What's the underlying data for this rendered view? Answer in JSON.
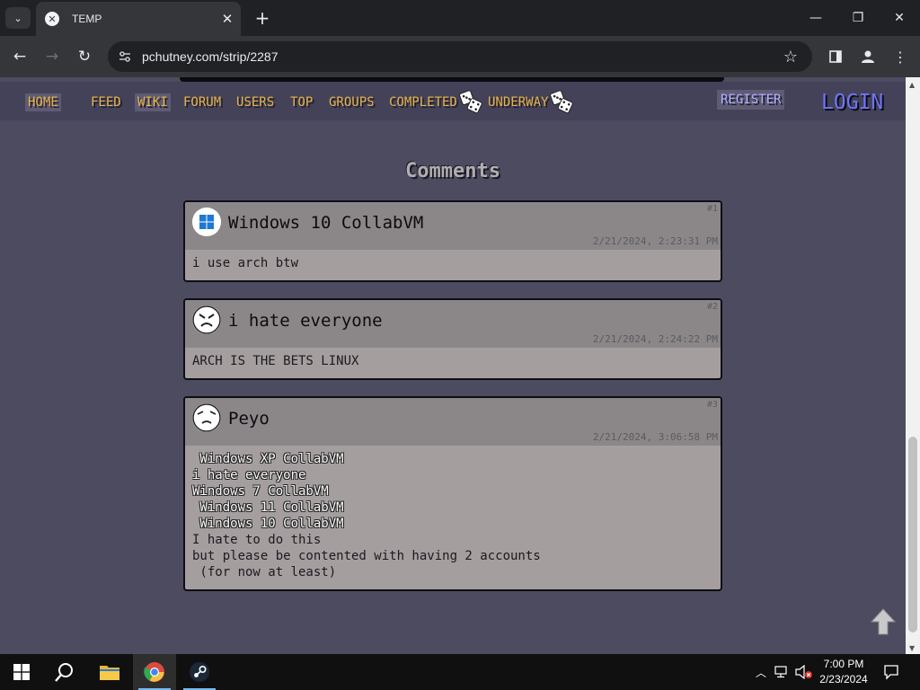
{
  "browser": {
    "tab": {
      "title": "TEMP",
      "favicon": "favicon-icon"
    },
    "url": "pchutney.com/strip/2287"
  },
  "site_nav": {
    "links": [
      "HOME",
      "FEED",
      "WIKI",
      "FORUM",
      "USERS",
      "TOP",
      "GROUPS",
      "COMPLETED",
      "UNDERWAY"
    ],
    "register": "REGISTER",
    "login": "LOGIN"
  },
  "comments": {
    "title": "Comments",
    "items": [
      {
        "user": "Windows 10 CollabVM",
        "number": "#1",
        "date": "2/21/2024, 2:23:31 PM",
        "avatar": "windows-logo-icon",
        "body": "i use arch btw"
      },
      {
        "user": "i hate everyone",
        "number": "#2",
        "date": "2/21/2024, 2:24:22 PM",
        "avatar": "angry-face-icon",
        "body": "ARCH IS THE BETS LINUX"
      },
      {
        "user": "Peyo",
        "number": "#3",
        "date": "2/21/2024, 3:06:58 PM",
        "avatar": "sad-face-icon",
        "body_outlined": [
          " Windows XP CollabVM",
          "i hate everyone",
          "Windows 7 CollabVM",
          " Windows 11 CollabVM",
          " Windows 10 CollabVM"
        ],
        "body_plain": [
          "I hate to do this",
          "but please be contented with having 2 accounts",
          " (for now at least)"
        ]
      }
    ]
  },
  "taskbar": {
    "time": "7:00 PM",
    "date": "2/23/2024"
  },
  "colors": {
    "page_bg": "#4d4b60",
    "nav_link": "#e6b34a",
    "login": "#6e74f5",
    "register": "#aab0ff",
    "comment_body": "#a59e9f",
    "comment_head": "#8b8789"
  }
}
